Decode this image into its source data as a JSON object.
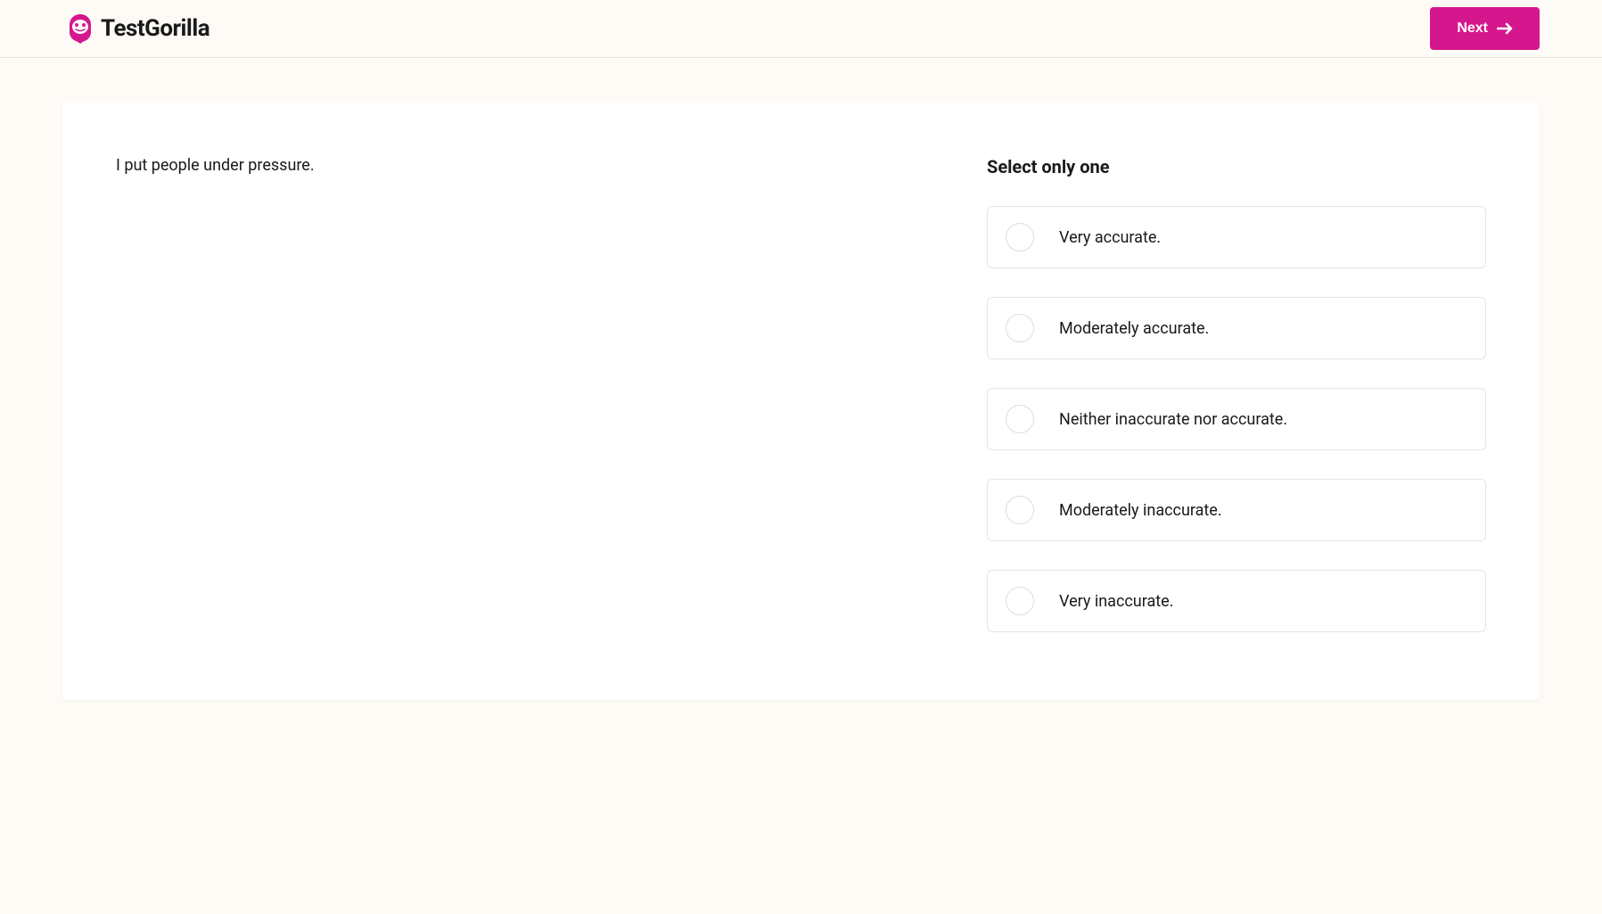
{
  "header": {
    "logo_text": "TestGorilla",
    "next_button_label": "Next"
  },
  "question": {
    "text": "I put people under pressure."
  },
  "answers": {
    "instruction": "Select only one",
    "options": [
      {
        "label": "Very accurate."
      },
      {
        "label": "Moderately accurate."
      },
      {
        "label": "Neither inaccurate nor accurate."
      },
      {
        "label": "Moderately inaccurate."
      },
      {
        "label": "Very inaccurate."
      }
    ]
  },
  "colors": {
    "brand": "#d4178d",
    "background": "#fefbf7",
    "card": "#ffffff",
    "text": "#1a1a1a",
    "border": "#e8e4e0"
  }
}
